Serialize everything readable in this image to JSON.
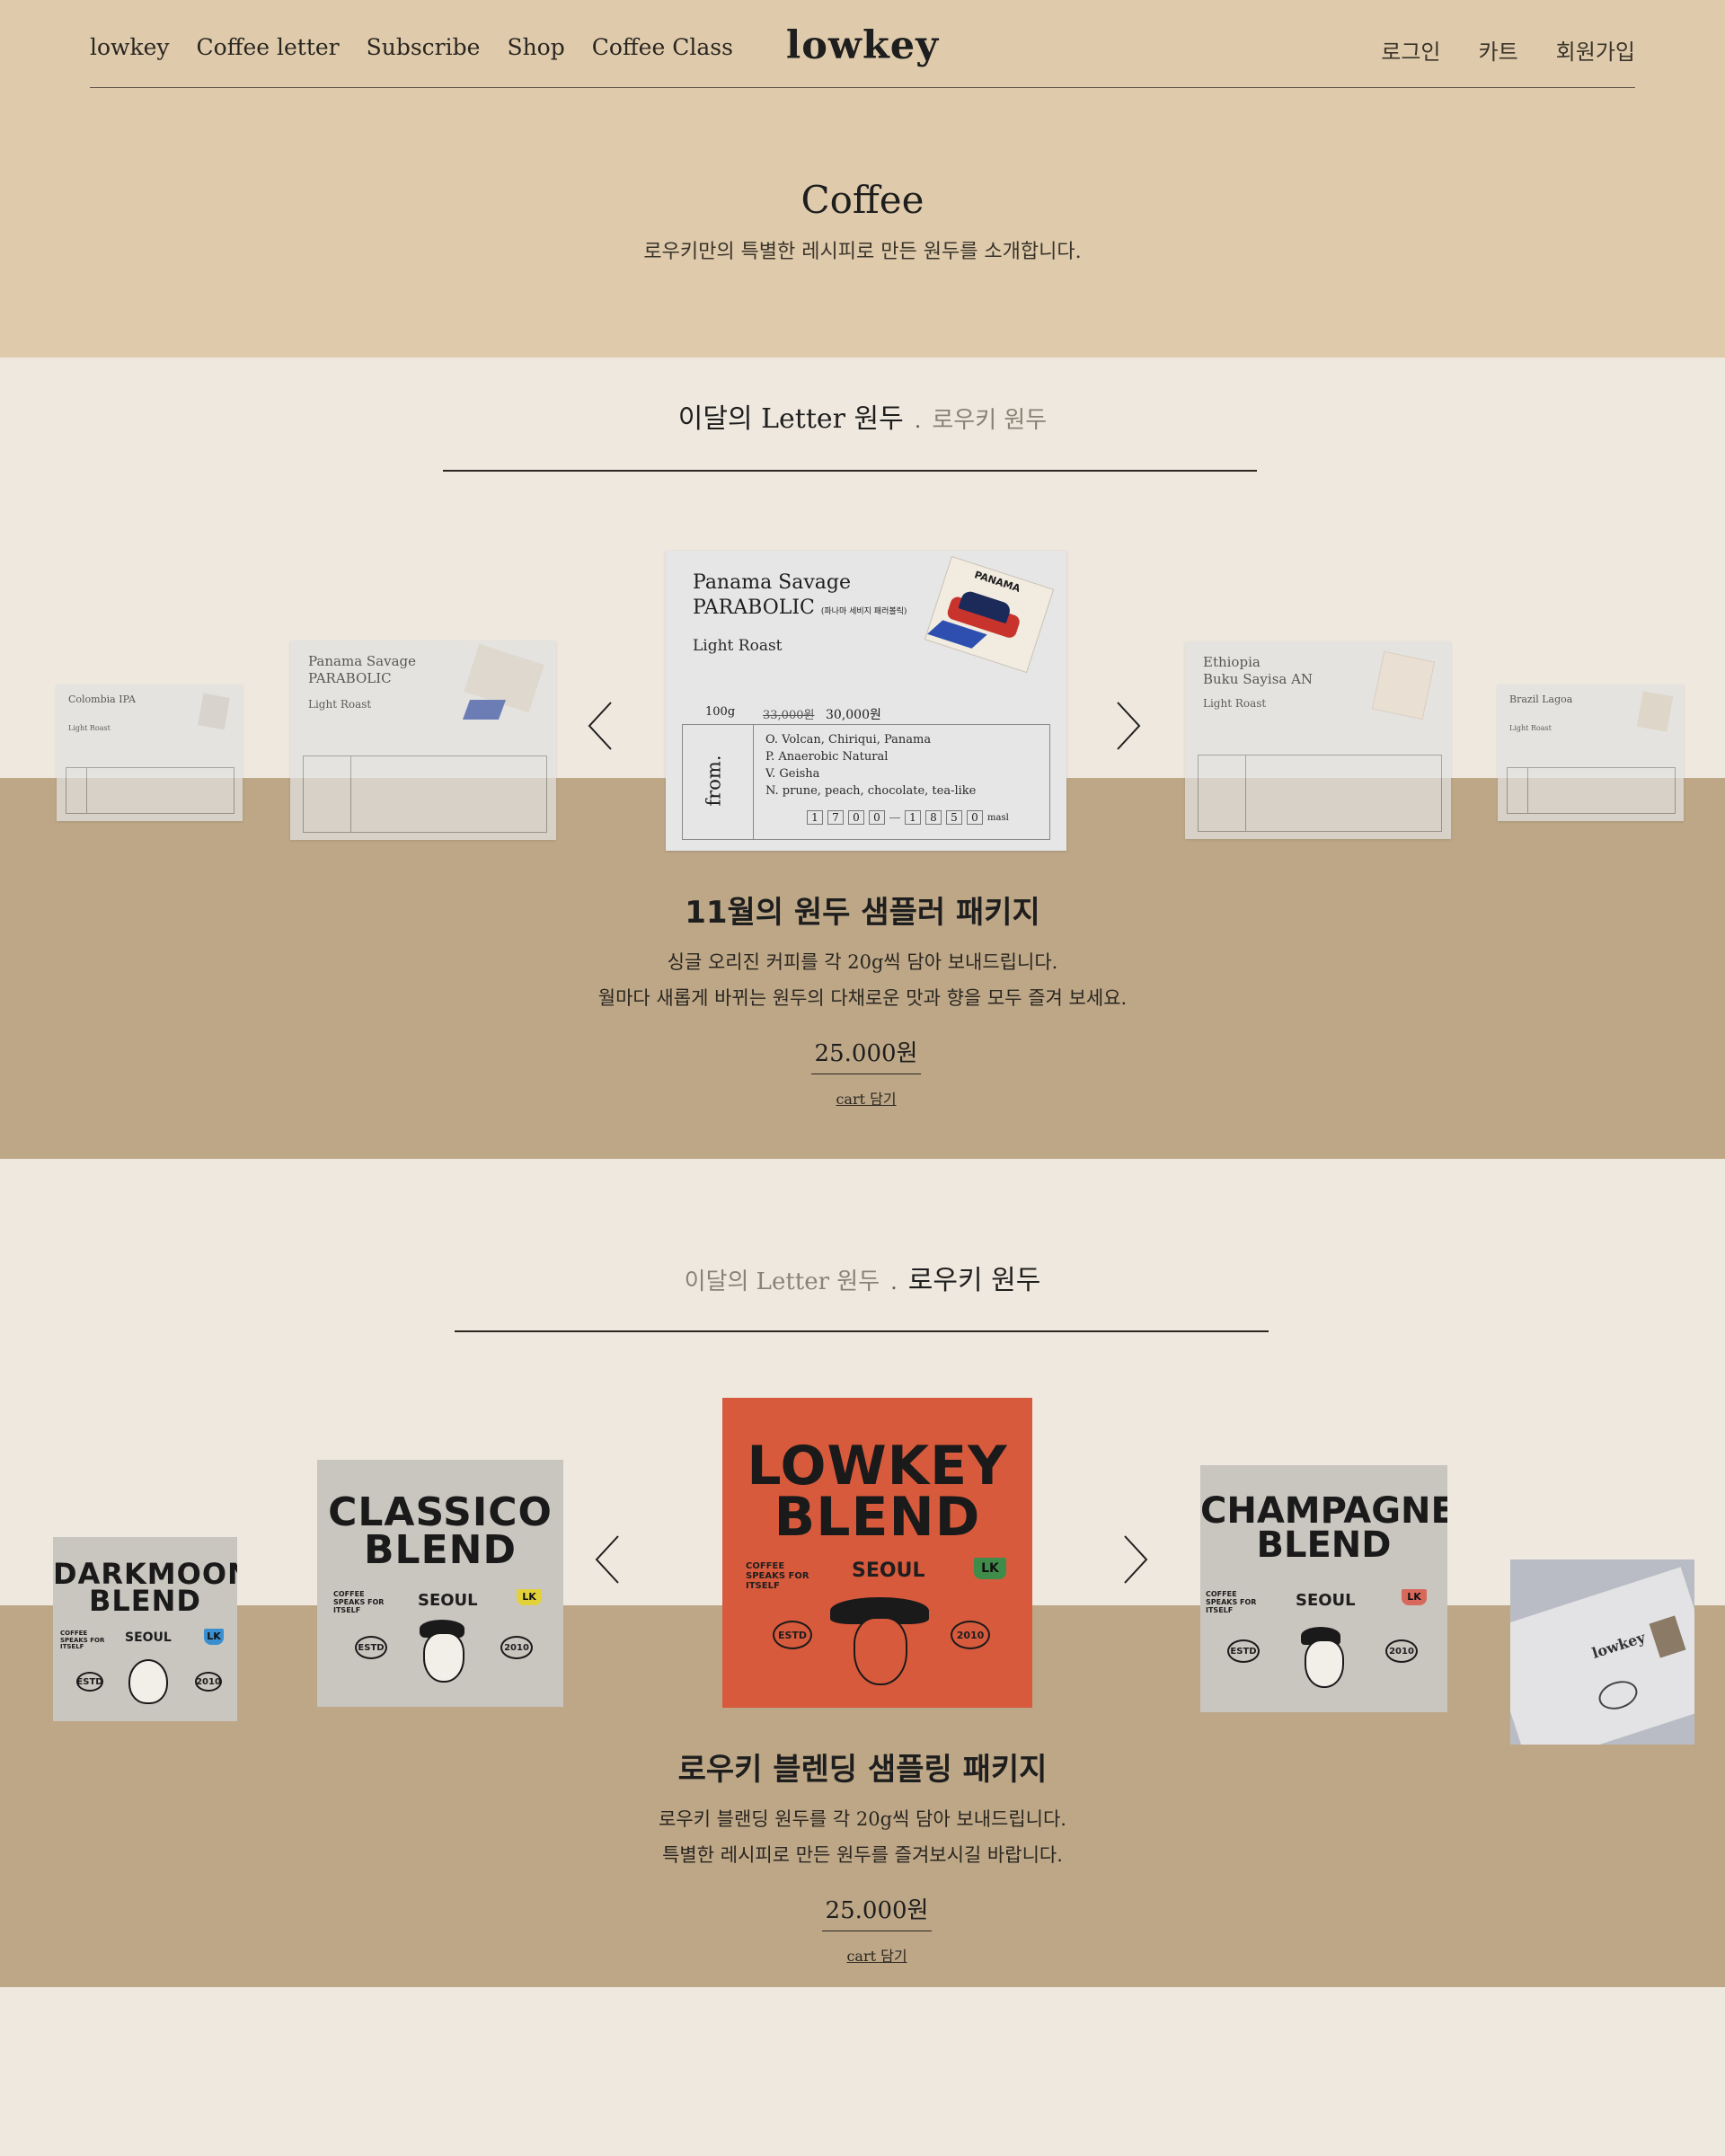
{
  "header": {
    "nav": [
      "lowkey",
      "Coffee letter",
      "Subscribe",
      "Shop",
      "Coffee Class"
    ],
    "logo": "lowkey",
    "user_nav": [
      "로그인",
      "카트",
      "회원가입"
    ]
  },
  "hero": {
    "title": "Coffee",
    "subtitle": "로우키만의 특별한 레시피로 만든 원두를 소개합니다."
  },
  "letter_section": {
    "tab_active": "이달의 Letter 원두",
    "separator": ".",
    "tab_inactive": "로우키 원두",
    "cards": [
      {
        "name": "Colombia IPA",
        "roast": "Light Roast"
      },
      {
        "name_line1": "Panama Savage",
        "name_line2": "PARABOLIC",
        "roast": "Light Roast"
      },
      {
        "name_line1": "Panama Savage",
        "name_line2": "PARABOLIC",
        "name_sub": "(파나마 세비지 패러볼릭)",
        "roast": "Light Roast",
        "weight": "100g",
        "old_price": "33,000원",
        "price": "30,000원",
        "from_label": "from.",
        "notes": [
          "O. Volcan, Chiriqui, Panama",
          "P. Anaerobic Natural",
          "V. Geisha",
          "N. prune, peach, chocolate, tea-like"
        ],
        "code_a": [
          "1",
          "7",
          "0",
          "0"
        ],
        "code_b": [
          "1",
          "8",
          "5",
          "0"
        ],
        "unit": "masl",
        "stamp": "PANAMA"
      },
      {
        "name_line1": "Ethiopia",
        "name_line2": "Buku Sayisa AN",
        "roast": "Light Roast"
      },
      {
        "name": "Brazil Lagoa",
        "roast": "Light Roast"
      }
    ],
    "product": {
      "title": "11월의 원두 샘플러 패키지",
      "desc_line1": "싱글 오리진 커피를 각 20g씩 담아 보내드립니다.",
      "desc_line2": "월마다 새롭게 바뀌는 원두의 다채로운 맛과 향을 모두 즐겨 보세요.",
      "price": "25.000원",
      "cart": "cart 담기"
    }
  },
  "blend_section": {
    "tab_inactive": "이달의 Letter 원두",
    "separator": ".",
    "tab_active": "로우키 원두",
    "covers": [
      {
        "line1": "DARKMOON",
        "line2": "BLEND",
        "tag": "COFFEE SPEAKS FOR ITSELF",
        "city": "SEOUL",
        "badge": "LK",
        "estd": "ESTD",
        "year": "2010",
        "bg": "#c9c5bf",
        "badge_color": "#3a8fd0"
      },
      {
        "line1": "CLASSICO",
        "line2": "BLEND",
        "tag": "COFFEE SPEAKS FOR ITSELF",
        "city": "SEOUL",
        "badge": "LK",
        "estd": "ESTD",
        "year": "2010",
        "bg": "#c9c5bf",
        "badge_color": "#e3d13a"
      },
      {
        "line1": "LOWKEY",
        "line2": "BLEND",
        "tag": "COFFEE SPEAKS FOR ITSELF",
        "city": "SEOUL",
        "badge": "LK",
        "estd": "ESTD",
        "year": "2010",
        "bg": "#d85a3c",
        "badge_color": "#3f8c4a"
      },
      {
        "line1": "CHAMPAGNE",
        "line2": "BLEND",
        "tag": "COFFEE SPEAKS FOR ITSELF",
        "city": "SEOUL",
        "badge": "LK",
        "estd": "ESTD",
        "year": "2010",
        "bg": "#c9c5bf",
        "badge_color": "#d8685c"
      },
      {
        "logo": "lowkey",
        "bg": "#b9bcc4"
      }
    ],
    "product": {
      "title": "로우키 블렌딩 샘플링 패키지",
      "desc_line1": "로우키 블랜딩 원두를 각 20g씩 담아 보내드립니다.",
      "desc_line2": "특별한 레시피로 만든 원두를 즐겨보시길 바랍니다.",
      "price": "25.000원",
      "cart": "cart 담기"
    }
  },
  "colors": {
    "hero_bg": "#dfcbac",
    "page_bg": "#efe8de",
    "band_bg": "#bda787",
    "text": "#1e1e1e"
  }
}
